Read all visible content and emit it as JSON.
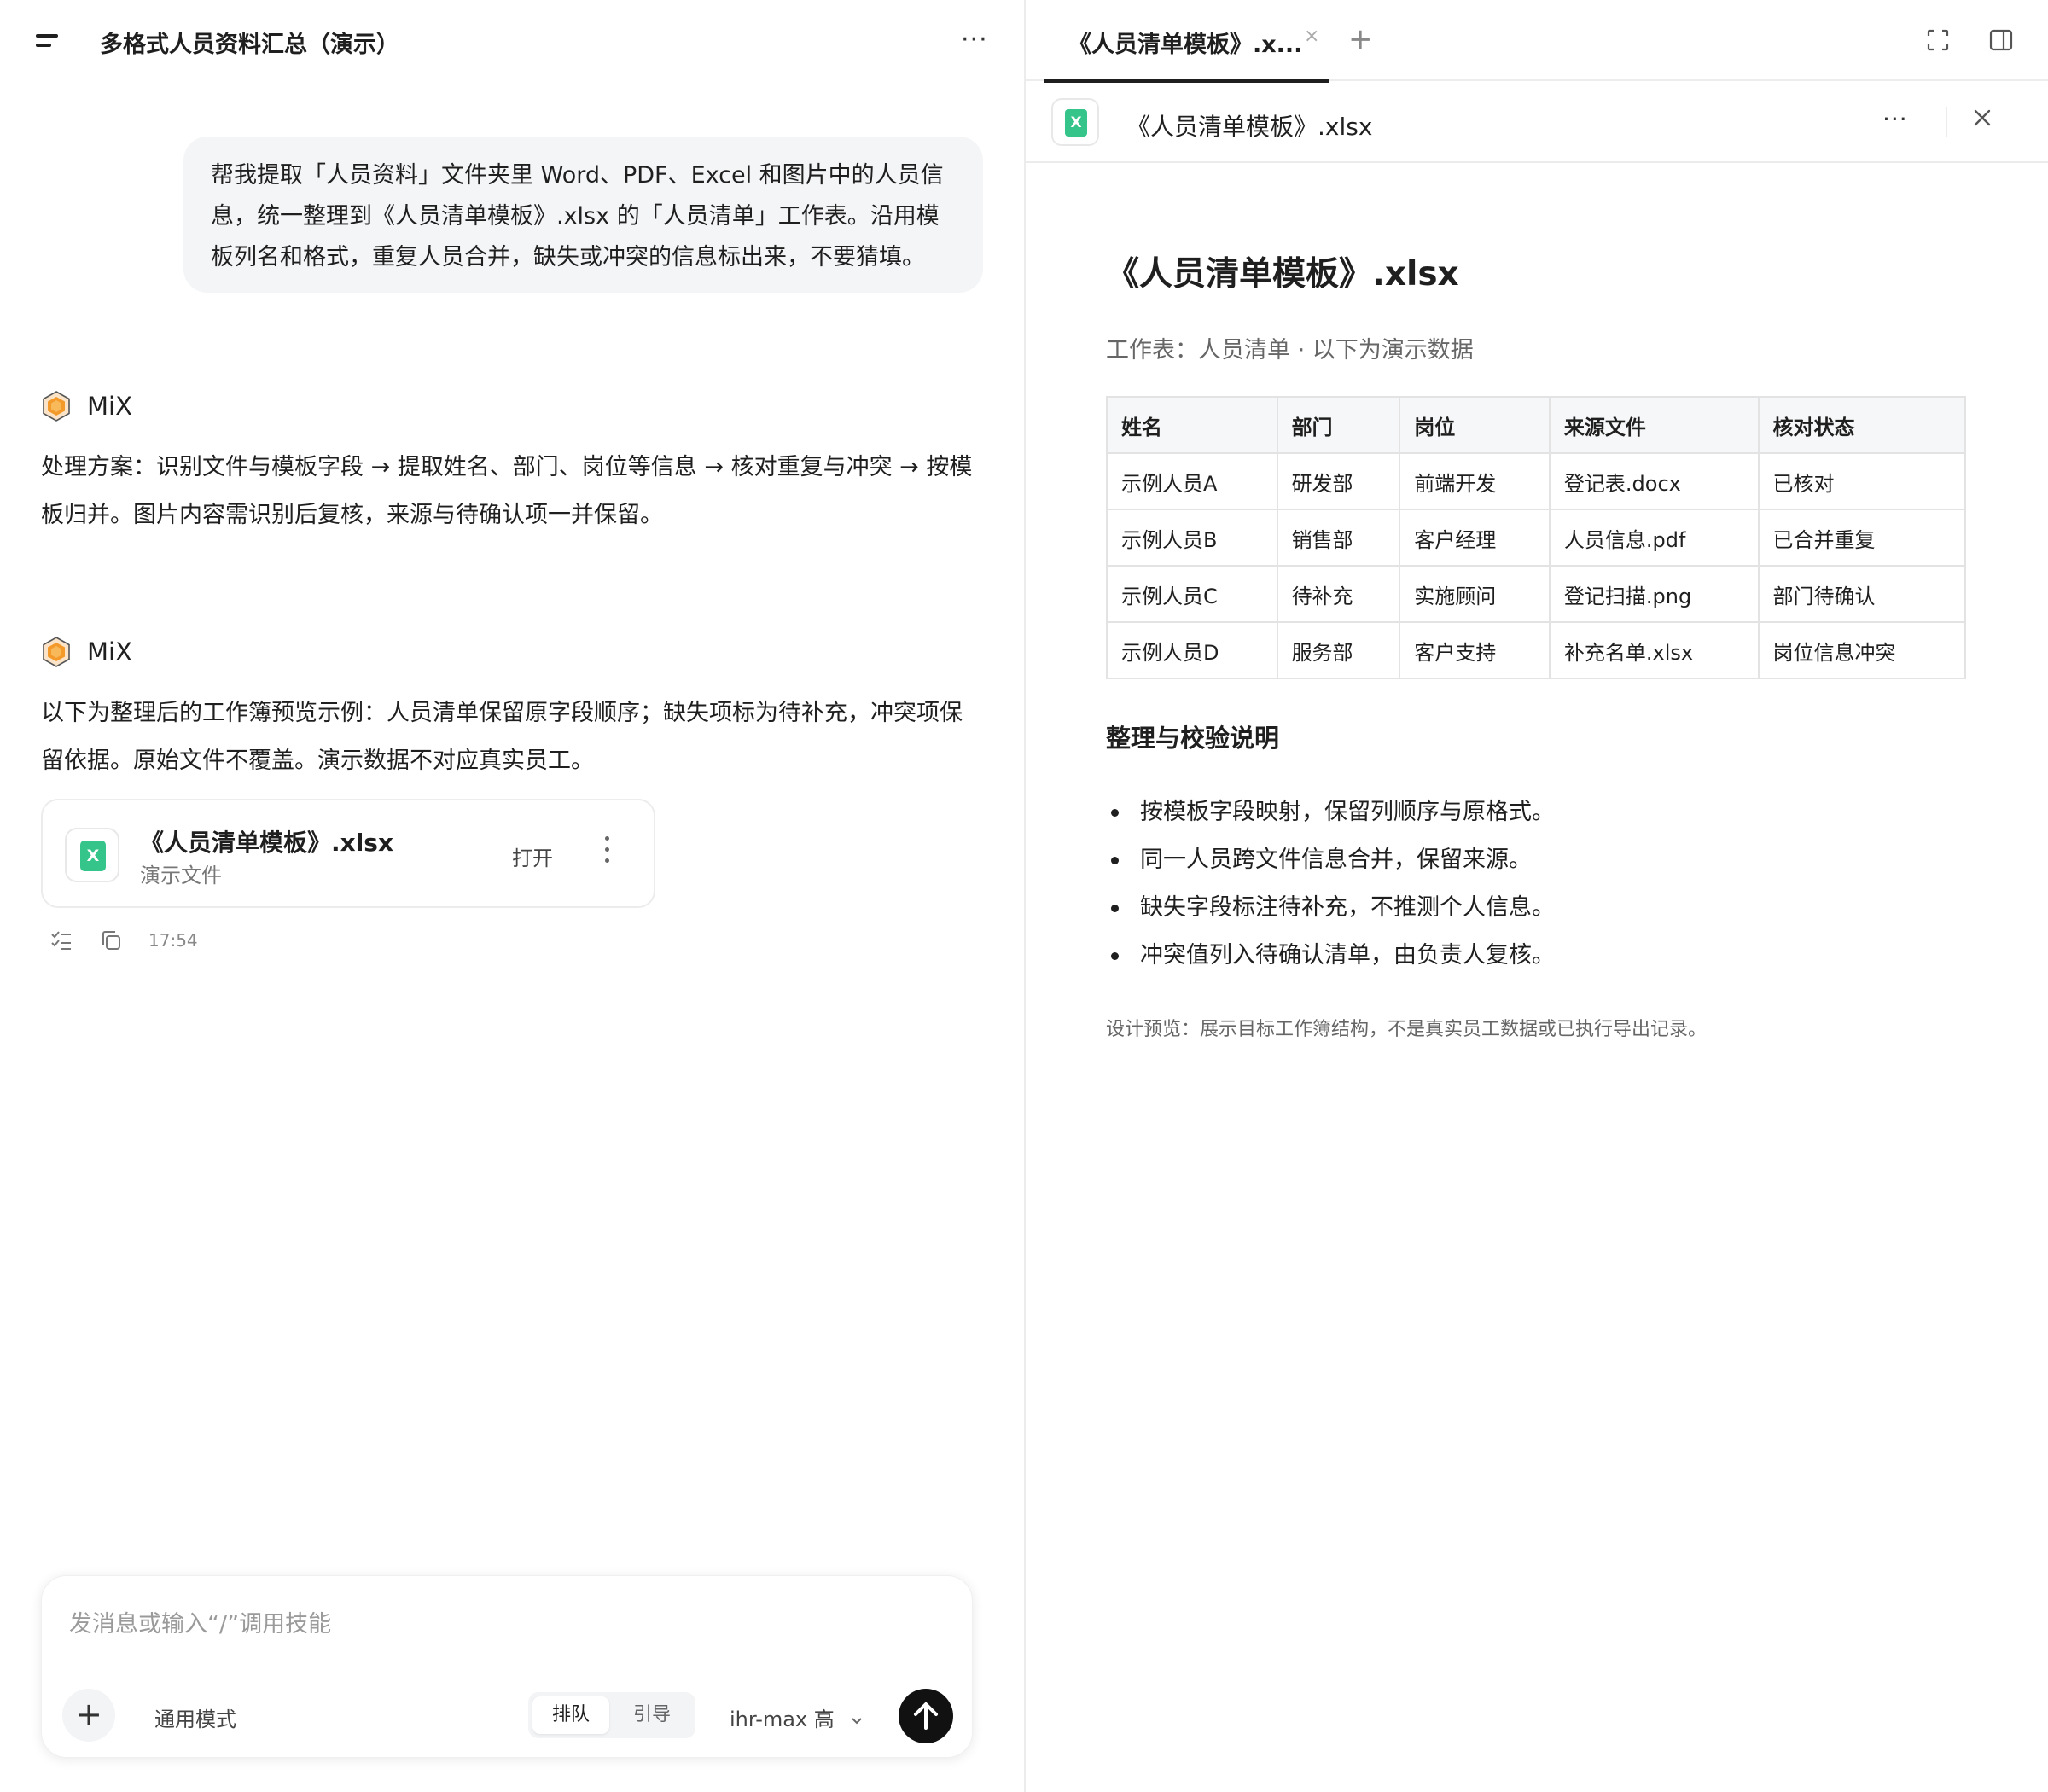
{
  "left": {
    "title": "多格式人员资料汇总（演示）",
    "more": "···",
    "user_message": "帮我提取「人员资料」文件夹里 Word、PDF、Excel 和图片中的人员信息，统一整理到《人员清单模板》.xlsx 的「人员清单」工作表。沿用模板列名和格式，重复人员合并，缺失或冲突的信息标出来，不要猜填。",
    "bot_name": "MiX",
    "bot_message_1": "处理方案：识别文件与模板字段 → 提取姓名、部门、岗位等信息 → 核对重复与冲突 → 按模板归并。图片内容需识别后复核，来源与待确认项一并保留。",
    "bot_message_2": "以下为整理后的工作簿预览示例：人员清单保留原字段顺序；缺失项标为待补充，冲突项保留依据。原始文件不覆盖。演示数据不对应真实员工。",
    "file_card": {
      "icon_letter": "X",
      "name": "《人员清单模板》.xlsx",
      "subtitle": "演示文件",
      "open_label": "打开"
    },
    "timestamp": "17:54",
    "composer": {
      "placeholder": "发消息或输入“/”调用技能",
      "plus": "+",
      "mode": "通用模式",
      "seg_queue": "排队",
      "seg_guide": "引导",
      "model": "ihr-max 高"
    }
  },
  "right": {
    "tab_label": "《人员清单模板》.x...",
    "tab_close": "×",
    "tab_add": "+",
    "file_icon_letter": "X",
    "file_name": "《人员清单模板》.xlsx",
    "more": "···",
    "doc_title": "《人员清单模板》.xlsx",
    "doc_subtitle": "工作表：人员清单 · 以下为演示数据",
    "table": {
      "headers": [
        "姓名",
        "部门",
        "岗位",
        "来源文件",
        "核对状态"
      ],
      "rows": [
        [
          "示例人员A",
          "研发部",
          "前端开发",
          "登记表.docx",
          "已核对"
        ],
        [
          "示例人员B",
          "销售部",
          "客户经理",
          "人员信息.pdf",
          "已合并重复"
        ],
        [
          "示例人员C",
          "待补充",
          "实施顾问",
          "登记扫描.png",
          "部门待确认"
        ],
        [
          "示例人员D",
          "服务部",
          "客户支持",
          "补充名单.xlsx",
          "岗位信息冲突"
        ]
      ]
    },
    "notes_heading": "整理与校验说明",
    "notes": [
      "按模板字段映射，保留列顺序与原格式。",
      "同一人员跨文件信息合并，保留来源。",
      "缺失字段标注待补充，不推测个人信息。",
      "冲突值列入待确认清单，由负责人复核。"
    ],
    "footnote": "设计预览：展示目标工作簿结构，不是真实员工数据或已执行导出记录。"
  },
  "colors": {
    "excel_green": "#35c48a",
    "send_button": "#111111",
    "bubble_bg": "#f4f5f7",
    "avatar_orange": "#f39a2b"
  },
  "icons": {
    "menu": "menu-icon",
    "avatar": "mix-avatar-icon",
    "file": "excel-file-icon",
    "send": "arrow-up-icon",
    "expand": "expand-icon",
    "panel": "side-panel-icon",
    "close": "close-icon"
  }
}
